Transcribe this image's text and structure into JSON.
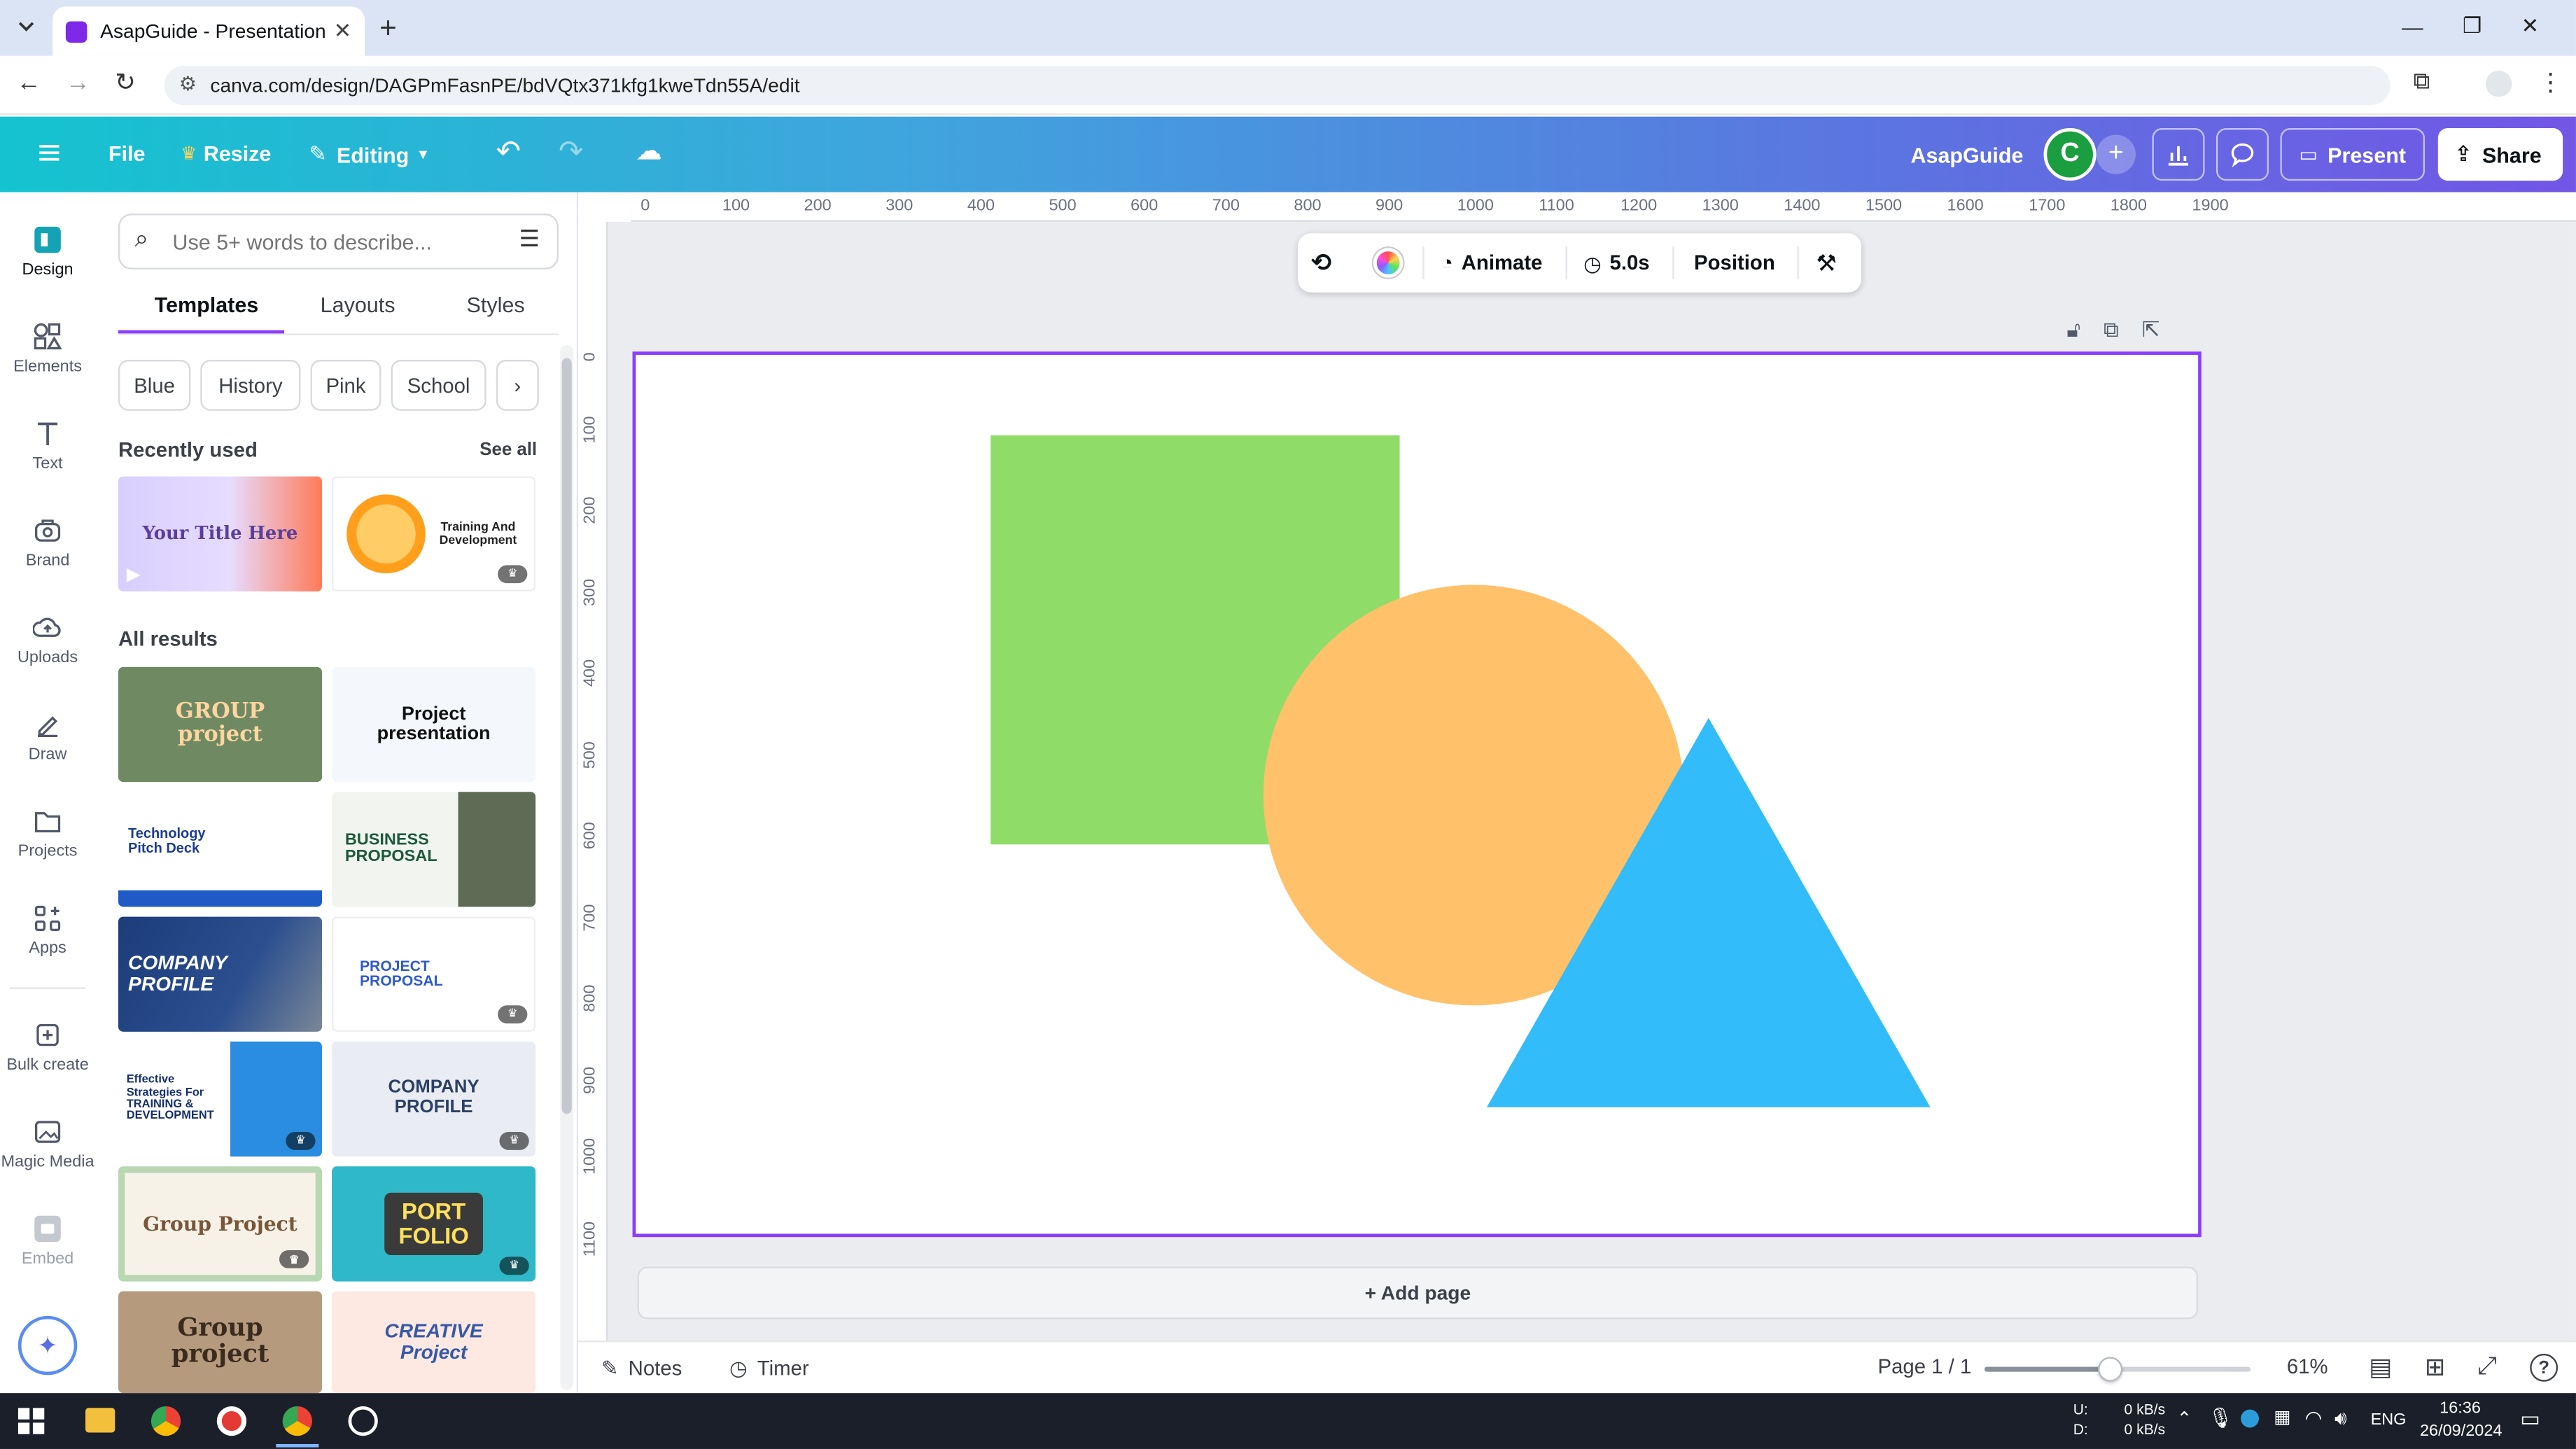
{
  "browser": {
    "tab_title": "AsapGuide - Presentation",
    "url": "canva.com/design/DAGPmFasnPE/bdVQtx371kfg1kweTdn55A/edit"
  },
  "header": {
    "file": "File",
    "resize": "Resize",
    "editing": "Editing",
    "project_name": "AsapGuide",
    "avatar_letter": "C",
    "present": "Present",
    "share": "Share"
  },
  "rail": [
    {
      "label": "Design",
      "icon": "design-icon"
    },
    {
      "label": "Elements",
      "icon": "elements-icon"
    },
    {
      "label": "Text",
      "icon": "text-icon"
    },
    {
      "label": "Brand",
      "icon": "brand-icon"
    },
    {
      "label": "Uploads",
      "icon": "uploads-icon"
    },
    {
      "label": "Draw",
      "icon": "draw-icon"
    },
    {
      "label": "Projects",
      "icon": "projects-icon"
    },
    {
      "label": "Apps",
      "icon": "apps-icon"
    },
    {
      "label": "Bulk create",
      "icon": "bulk-create-icon"
    },
    {
      "label": "Magic Media",
      "icon": "magic-media-icon"
    },
    {
      "label": "Embed",
      "icon": "embed-icon"
    }
  ],
  "panel": {
    "search_placeholder": "Use 5+ words to describe...",
    "tabs": [
      "Templates",
      "Layouts",
      "Styles"
    ],
    "chips": [
      "Blue",
      "History",
      "Pink",
      "School"
    ],
    "recently_used": "Recently used",
    "see_all": "See all",
    "all_results": "All results",
    "recent_thumbs": [
      {
        "text": "Your Title Here"
      },
      {
        "text": "Training And Development"
      }
    ],
    "results": [
      {
        "text": "GROUP project"
      },
      {
        "text": "Project presentation"
      },
      {
        "text": "Technology Pitch Deck"
      },
      {
        "text": "BUSINESS PROPOSAL"
      },
      {
        "text": "COMPANY PROFILE"
      },
      {
        "text": "PROJECT PROPOSAL"
      },
      {
        "text": "Effective Strategies For TRAINING & DEVELOPMENT"
      },
      {
        "text": "COMPANY PROFILE"
      },
      {
        "text": "Group Project"
      },
      {
        "text": "PORT FOLIO"
      },
      {
        "text": "Group project"
      },
      {
        "text": "CREATIVE Project"
      }
    ]
  },
  "toolbar": {
    "animate": "Animate",
    "duration": "5.0s",
    "position": "Position"
  },
  "rulers": {
    "top": [
      "0",
      "100",
      "200",
      "300",
      "400",
      "500",
      "600",
      "700",
      "800",
      "900",
      "1000",
      "1100",
      "1200",
      "1300",
      "1400",
      "1500",
      "1600",
      "1700",
      "1800",
      "1900"
    ],
    "left": [
      "0",
      "100",
      "200",
      "300",
      "400",
      "500",
      "600",
      "700",
      "800",
      "900",
      "1000",
      "1100"
    ]
  },
  "canvas": {
    "add_page": "+ Add page",
    "shapes": {
      "square_color": "#8fdc69",
      "circle_color": "#ffc16a",
      "triangle_color": "#32bcf9"
    }
  },
  "footer": {
    "notes": "Notes",
    "timer": "Timer",
    "page": "Page 1 / 1",
    "zoom_fraction": 0.47,
    "zoom": "61%"
  },
  "taskbar": {
    "net_up": "0 kB/s",
    "net_down": "0 kB/s",
    "net_up_label": "U:",
    "net_down_label": "D:",
    "lang": "ENG",
    "time": "16:36",
    "date": "26/09/2024"
  },
  "colors": {
    "accent": "#8b3dff",
    "avatar_bg": "#1a9e3f"
  }
}
